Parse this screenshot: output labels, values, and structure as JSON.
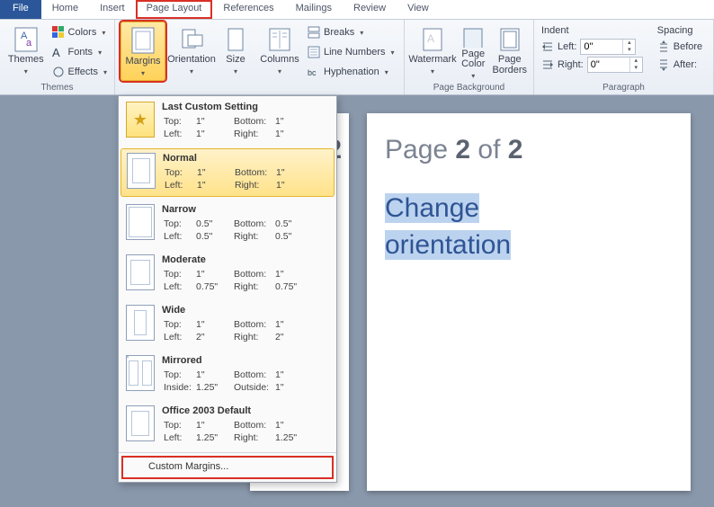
{
  "tabs": {
    "file": "File",
    "home": "Home",
    "insert": "Insert",
    "page_layout": "Page Layout",
    "references": "References",
    "mailings": "Mailings",
    "review": "Review",
    "view": "View"
  },
  "ribbon": {
    "themes": {
      "label": "Themes",
      "themes_btn": "Themes",
      "colors": "Colors",
      "fonts": "Fonts",
      "effects": "Effects"
    },
    "page_setup": {
      "margins": "Margins",
      "orientation": "Orientation",
      "size": "Size",
      "columns": "Columns",
      "breaks": "Breaks",
      "line_numbers": "Line Numbers",
      "hyphenation": "Hyphenation"
    },
    "page_bg": {
      "label": "Page Background",
      "watermark": "Watermark",
      "page_color": "Page Color",
      "page_borders": "Page Borders"
    },
    "paragraph": {
      "label": "Paragraph",
      "indent": "Indent",
      "spacing": "Spacing",
      "left": "Left:",
      "right": "Right:",
      "before": "Before",
      "after": "After:",
      "left_val": "0\"",
      "right_val": "0\""
    }
  },
  "margins_menu": {
    "items": [
      {
        "title": "Last Custom Setting",
        "r1a": "Top:",
        "r1b": "1\"",
        "r1c": "Bottom:",
        "r1d": "1\"",
        "r2a": "Left:",
        "r2b": "1\"",
        "r2c": "Right:",
        "r2d": "1\""
      },
      {
        "title": "Normal",
        "r1a": "Top:",
        "r1b": "1\"",
        "r1c": "Bottom:",
        "r1d": "1\"",
        "r2a": "Left:",
        "r2b": "1\"",
        "r2c": "Right:",
        "r2d": "1\""
      },
      {
        "title": "Narrow",
        "r1a": "Top:",
        "r1b": "0.5\"",
        "r1c": "Bottom:",
        "r1d": "0.5\"",
        "r2a": "Left:",
        "r2b": "0.5\"",
        "r2c": "Right:",
        "r2d": "0.5\""
      },
      {
        "title": "Moderate",
        "r1a": "Top:",
        "r1b": "1\"",
        "r1c": "Bottom:",
        "r1d": "1\"",
        "r2a": "Left:",
        "r2b": "0.75\"",
        "r2c": "Right:",
        "r2d": "0.75\""
      },
      {
        "title": "Wide",
        "r1a": "Top:",
        "r1b": "1\"",
        "r1c": "Bottom:",
        "r1d": "1\"",
        "r2a": "Left:",
        "r2b": "2\"",
        "r2c": "Right:",
        "r2d": "2\""
      },
      {
        "title": "Mirrored",
        "r1a": "Top:",
        "r1b": "1\"",
        "r1c": "Bottom:",
        "r1d": "1\"",
        "r2a": "Inside:",
        "r2b": "1.25\"",
        "r2c": "Outside:",
        "r2d": "1\""
      },
      {
        "title": "Office 2003 Default",
        "r1a": "Top:",
        "r1b": "1\"",
        "r1c": "Bottom:",
        "r1d": "1\"",
        "r2a": "Left:",
        "r2b": "1.25\"",
        "r2c": "Right:",
        "r2d": "1.25\""
      }
    ],
    "custom": "Custom Margins..."
  },
  "pages": {
    "p1_partial": "2",
    "p2_title_a": "Page ",
    "p2_title_b": "2",
    "p2_title_c": " of ",
    "p2_title_d": "2",
    "p2_line1": "Change ",
    "p2_line2": "orientation"
  }
}
